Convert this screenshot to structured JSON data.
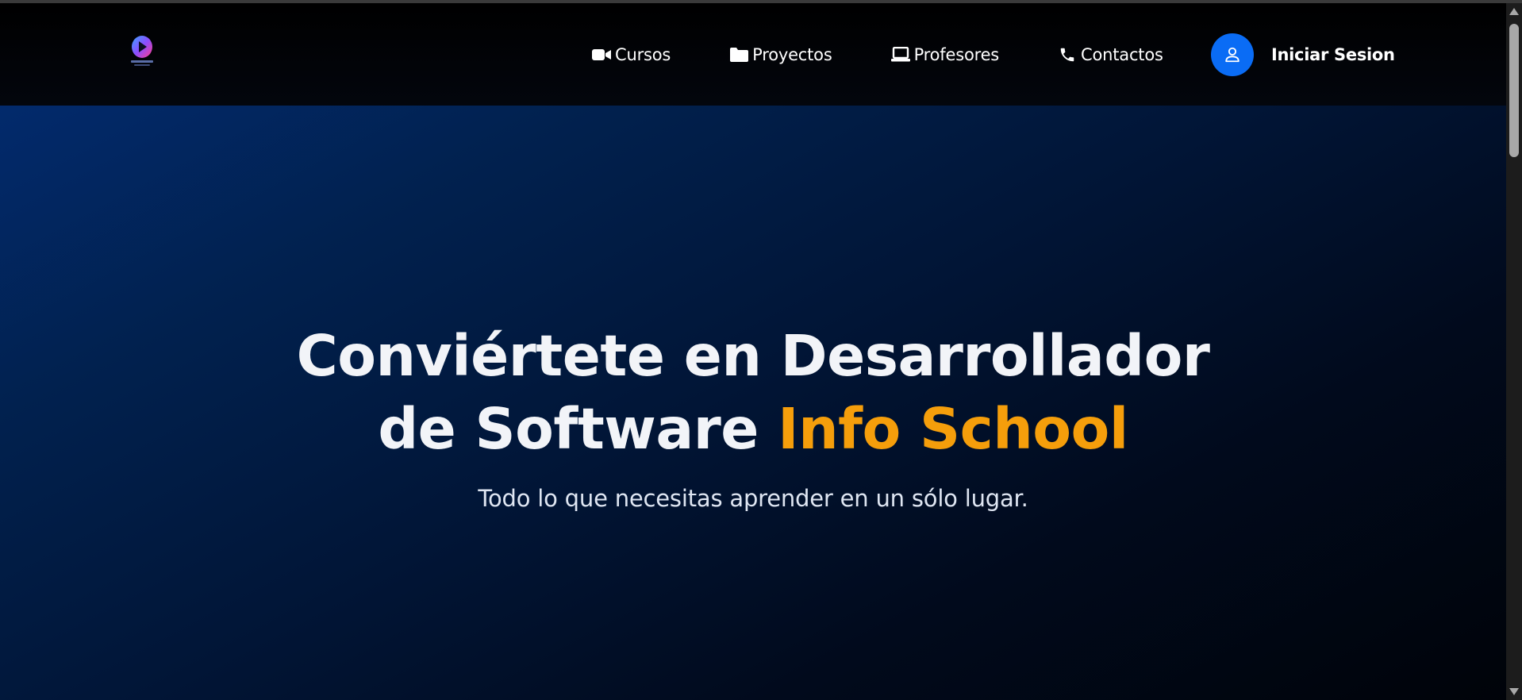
{
  "nav": {
    "logo_name": "brain-play-logo",
    "links": [
      {
        "label": "Cursos",
        "icon": "video-camera-icon"
      },
      {
        "label": "Proyectos",
        "icon": "folder-icon"
      },
      {
        "label": "Profesores",
        "icon": "laptop-icon"
      },
      {
        "label": "Contactos",
        "icon": "phone-icon"
      }
    ],
    "login": {
      "label": "Iniciar Sesion",
      "icon": "user-icon"
    }
  },
  "hero": {
    "title_line1": "Conviértete en Desarrollador",
    "title_line2_prefix": "de Software",
    "title_accent": "Info School",
    "subtitle": "Todo lo que necesitas aprender en un sólo lugar."
  },
  "colors": {
    "accent": "#f59e0b",
    "login_button": "#0a6cf5",
    "hero_gradient_start": "#022a6c",
    "hero_gradient_end": "#000309",
    "nav_background": "#000000"
  }
}
